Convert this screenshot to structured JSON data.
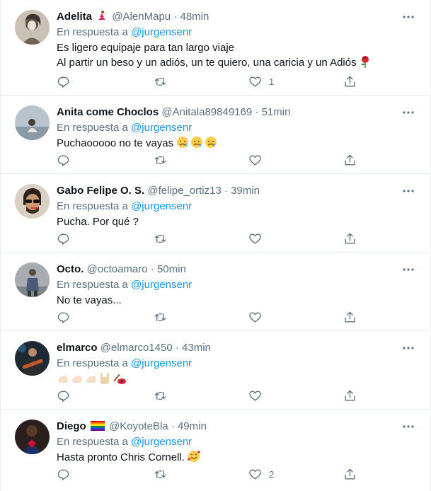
{
  "reply_prefix": "En respuesta a",
  "tweets": [
    {
      "name": "Adelita",
      "handle": "@AlenMapu",
      "time": "48min",
      "reply_to": "@jurgensenr",
      "lines": [
        "Es ligero equipaje para tan largo viaje",
        "Al partir un beso y un adiós, un te quiero, una caricia y un Adiós"
      ],
      "likes": "1",
      "avatar_icon": "vintage-portrait",
      "name_emoji": "dancer-emoji",
      "text_emoji": "rose-emoji"
    },
    {
      "name": "Anita come Choclos",
      "handle": "@Anitala89849169",
      "time": "51min",
      "reply_to": "@jurgensenr",
      "lines": [
        "Puchaooooo no te vayas"
      ],
      "likes": "",
      "avatar_icon": "person-sitting",
      "text_emoji": "sad-relieved-face-emoji"
    },
    {
      "name": "Gabo Felipe O. S.",
      "handle": "@felipe_ortiz13",
      "time": "39min",
      "reply_to": "@jurgensenr",
      "lines": [
        "Pucha. Por qué ?"
      ],
      "likes": "",
      "avatar_icon": "man-with-sunglasses"
    },
    {
      "name": "Octo.",
      "handle": "@octoamaro",
      "time": "50min",
      "reply_to": "@jurgensenr",
      "lines": [
        "No te vayas..."
      ],
      "likes": "",
      "avatar_icon": "person-street"
    },
    {
      "name": "elmarco",
      "handle": "@elmarco1450",
      "time": "43min",
      "reply_to": "@jurgensenr",
      "lines": [
        ""
      ],
      "likes": "",
      "avatar_icon": "guitarist",
      "text_emoji": "flexed-biceps-rock-hand-guitar-emoji"
    },
    {
      "name": "Diego",
      "handle": "@KoyoteBla",
      "time": "49min",
      "reply_to": "@jurgensenr",
      "lines": [
        "Hasta pronto Chris Cornell."
      ],
      "likes": "2",
      "avatar_icon": "superhero",
      "name_emoji": "rainbow-flag-emoji",
      "text_emoji": "smiling-face-with-hearts-emoji"
    }
  ],
  "colors": {
    "text": "#0f1419",
    "secondary": "#5b7083",
    "link": "#1b95e0",
    "divider": "#e6ecf0"
  }
}
